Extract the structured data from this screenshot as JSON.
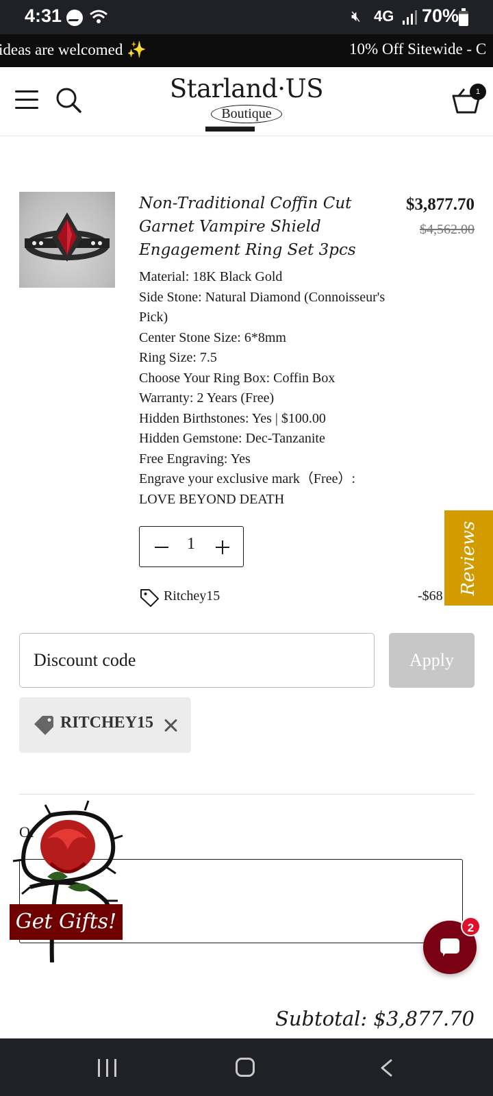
{
  "status_bar": {
    "time": "4:31",
    "network": "4G",
    "battery": "70%"
  },
  "announcement": {
    "left_text": "ideas are welcomed ✨",
    "right_text": "10% Off Sitewide - C"
  },
  "header": {
    "brand": "Starland·US",
    "sub_brand": "Boutique",
    "cart_count": "1"
  },
  "product": {
    "title": "Non-Traditional Coffin Cut Garnet Vampire Shield Engagement Ring Set 3pcs",
    "price": "$3,877.70",
    "original_price": "$4,562.00",
    "options": [
      "Material: 18K Black Gold",
      "Side Stone: Natural Diamond (Connoisseur's Pick)",
      "Center Stone Size: 6*8mm",
      "Ring Size: 7.5",
      "Choose Your Ring Box: Coffin Box",
      "Warranty: 2 Years (Free)",
      "Hidden Birthstones: Yes | $100.00",
      "Hidden Gemstone: Dec-Tanzanite",
      "Free Engraving: Yes",
      "Engrave your exclusive mark（Free）: LOVE BEYOND DEATH"
    ],
    "quantity": "1",
    "discount_code": "Ritchey15",
    "discount_amount": "-$68"
  },
  "reviews_tab": {
    "label": "Reviews"
  },
  "discount": {
    "placeholder": "Discount code",
    "apply_label": "Apply",
    "applied_code": "RITCHEY15"
  },
  "order_note": {
    "label": "Or"
  },
  "gift": {
    "label": "Get Gifts!"
  },
  "chat": {
    "badge": "2"
  },
  "subtotal": {
    "text": "Subtotal: $3,877.70"
  },
  "colors": {
    "accent_gold": "#d29b00",
    "chat_red": "#7a0014",
    "gift_red": "#6f0000",
    "badge_red": "#e0102b"
  },
  "icons": [
    "hamburger-menu-icon",
    "search-icon",
    "cart-icon",
    "tag-icon",
    "close-icon",
    "chat-icon",
    "recent-apps-icon",
    "home-icon",
    "back-icon"
  ]
}
